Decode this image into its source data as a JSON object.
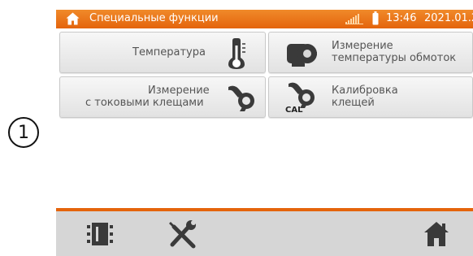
{
  "callout": {
    "number": "1"
  },
  "header": {
    "title": "Специальные функции",
    "time": "13:46",
    "date": "2021.01.27",
    "accent_color": "#e4640c"
  },
  "tiles": [
    {
      "label": "Температура",
      "icon": "thermometer-icon"
    },
    {
      "label_line1": "Измерение",
      "label_line2": "температуры обмоток",
      "icon": "motor-icon"
    },
    {
      "label_line1": "Измерение",
      "label_line2": "с токовыми клещами",
      "icon": "current-clamp-icon"
    },
    {
      "label_line1": "Калибровка",
      "label_line2": "клещей",
      "icon_text": "CAL",
      "icon": "clamp-calibration-icon"
    }
  ],
  "footer": {
    "icons": [
      "memory-icon",
      "settings-tools-icon",
      "home-icon"
    ]
  }
}
